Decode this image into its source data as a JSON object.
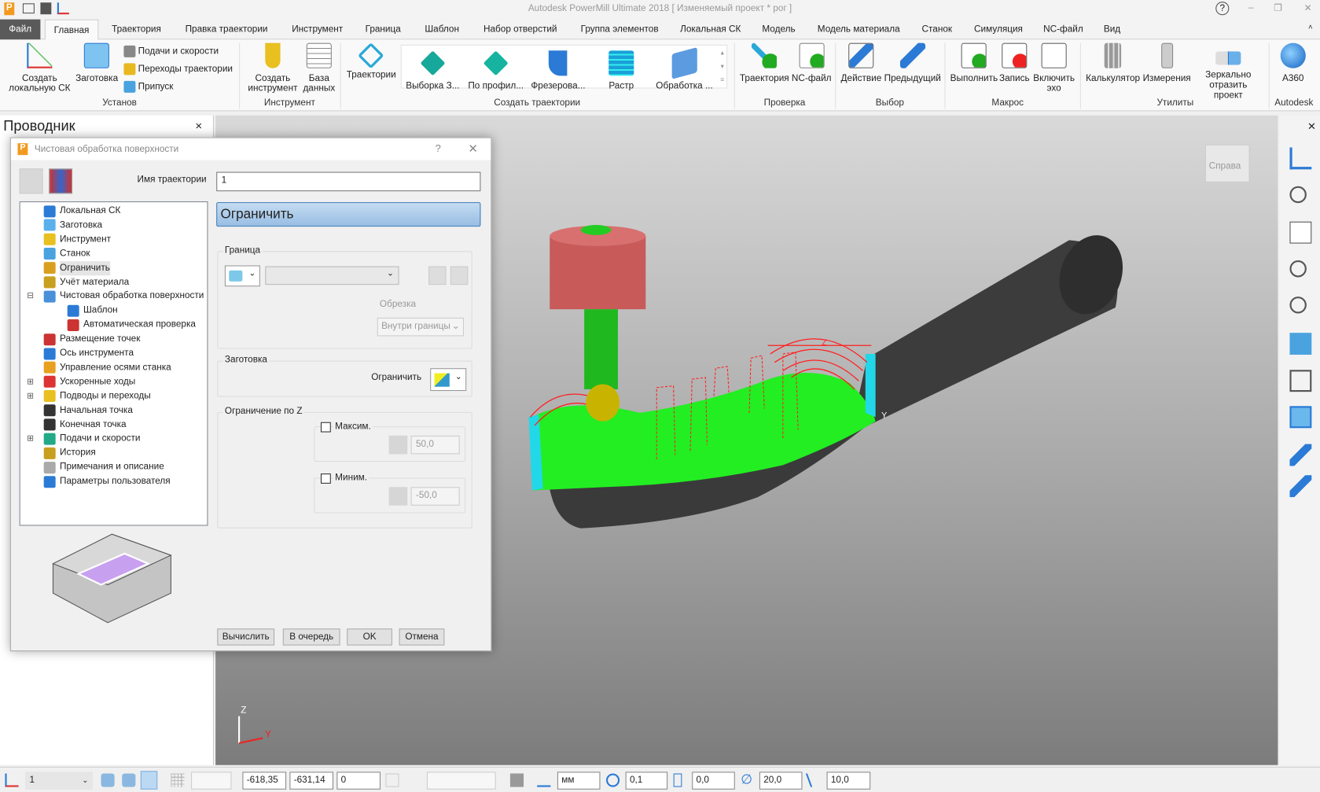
{
  "app": {
    "title": "Autodesk PowerMill Ultimate 2018   [ Изменяемый проект * рог ]",
    "help": "?",
    "minimize": "–",
    "restore": "❐",
    "close": "✕"
  },
  "tabs": [
    "Файл",
    "Главная",
    "Траектория",
    "Правка траектории",
    "Инструмент",
    "Граница",
    "Шаблон",
    "Набор отверстий",
    "Группа элементов",
    "Локальная СК",
    "Модель",
    "Модель материала",
    "Станок",
    "Симуляция",
    "NC-файл",
    "Вид"
  ],
  "active_tab": "Главная",
  "ribbon": {
    "groups": [
      "Установ",
      "Инструмент",
      "Создать траектории",
      "Проверка",
      "Выбор",
      "Макрос",
      "Утилиты",
      "Autodesk"
    ],
    "setup": {
      "create_cs": "Создать локальную СК",
      "stock": "Заготовка",
      "feeds": "Подачи и скорости",
      "links": "Переходы траектории",
      "thickness": "Припуск"
    },
    "tool": {
      "create_tool": "Создать инструмент",
      "database": "База данных"
    },
    "toolpaths": {
      "toolpaths": "Траектории",
      "gallery": [
        "Выборка З...",
        "По профил...",
        "Фрезерова...",
        "Растр",
        "Обработка ..."
      ]
    },
    "verify": {
      "toolpath": "Траектория",
      "ncfile": "NC-файл"
    },
    "select": {
      "action": "Действие",
      "previous": "Предыдущий"
    },
    "macro": {
      "run": "Выполнить",
      "record": "Запись",
      "echo": "Включить эхо"
    },
    "utils": {
      "calc": "Калькулятор",
      "measure": "Измерения",
      "mirror": "Зеркально отразить проект"
    },
    "autodesk": {
      "a360": "A360"
    }
  },
  "explorer": {
    "title": "Проводник",
    "close": "×"
  },
  "viewport": {
    "view_cube_label": "Справа",
    "axis_z": "Z",
    "axis_y": "Y"
  },
  "dialog": {
    "title": "Чистовая обработка поверхности",
    "help": "?",
    "close": "✕",
    "name_label": "Имя траектории",
    "name_value": "1",
    "tree": [
      "Локальная СК",
      "Заготовка",
      "Инструмент",
      "Станок",
      "Ограничить",
      "Учёт материала",
      "Чистовая обработка поверхности",
      "Шаблон",
      "Автоматическая проверка",
      "Размещение точек",
      "Ось инструмента",
      "Управление осями станка",
      "Ускоренные ходы",
      "Подводы и переходы",
      "Начальная точка",
      "Конечная точка",
      "Подачи и скорости",
      "История",
      "Примечания и описание",
      "Параметры пользователя"
    ],
    "selected_item": "Ограничить",
    "page_header": "Ограничить",
    "boundary": {
      "label": "Граница",
      "boundary_value": "",
      "trim_label": "Обрезка",
      "trim_value": "Внутри границы"
    },
    "stock": {
      "label": "Заготовка",
      "limit_label": "Ограничить"
    },
    "zlimit": {
      "label": "Ограничение по Z",
      "max_label": "Максим.",
      "max_checked": false,
      "max_value": "50,0",
      "min_label": "Миним.",
      "min_checked": false,
      "min_value": "-50,0"
    },
    "buttons": {
      "calculate": "Вычислить",
      "queue": "В очередь",
      "ok": "OK",
      "cancel": "Отмена"
    }
  },
  "status": {
    "workplane": "1",
    "x": "-618,35",
    "y": "-631,14",
    "z": "0",
    "units": "мм",
    "tolerance": "0,1",
    "thickness": "0,0",
    "diameter": "20,0",
    "stepover": "10,0"
  },
  "colors": {
    "accent": "#2b7bd6",
    "header_blue": "#a9c8e6",
    "surface_green": "#22ee22",
    "toolpath_red": "#ff1a1a",
    "tube": "#3c3c3c"
  }
}
